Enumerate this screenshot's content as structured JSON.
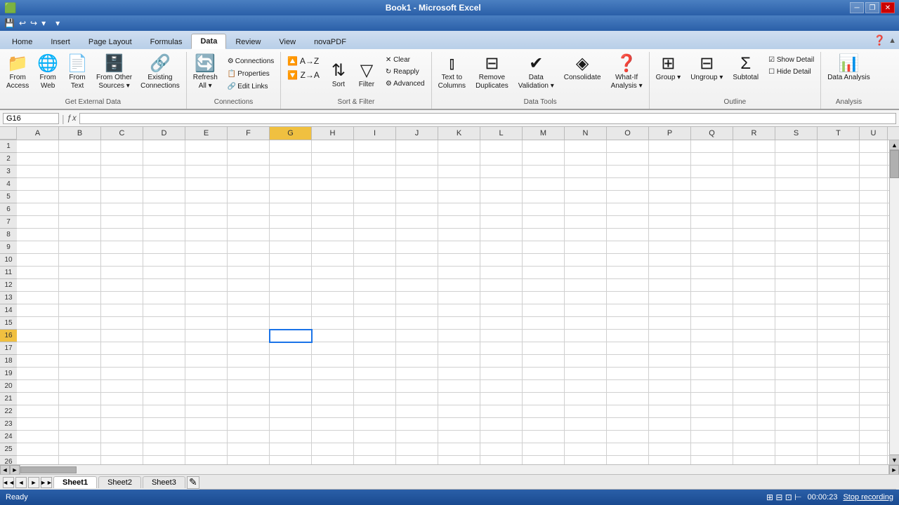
{
  "titleBar": {
    "title": "Book1 - Microsoft Excel",
    "minBtn": "─",
    "restoreBtn": "❐",
    "closeBtn": "✕"
  },
  "quickAccess": {
    "buttons": [
      "💾",
      "↩",
      "↪",
      "▾"
    ]
  },
  "ribbonTabs": {
    "tabs": [
      "Home",
      "Insert",
      "Page Layout",
      "Formulas",
      "Data",
      "Review",
      "View",
      "novaPDF"
    ],
    "activeTab": "Data"
  },
  "ribbon": {
    "groups": [
      {
        "id": "get-external-data",
        "label": "Get External Data",
        "buttons": [
          {
            "id": "from-access",
            "label": "From\nAccess",
            "icon": "📁"
          },
          {
            "id": "from-web",
            "label": "From\nWeb",
            "icon": "🌐"
          },
          {
            "id": "from-text",
            "label": "From\nText",
            "icon": "📄"
          },
          {
            "id": "from-other-sources",
            "label": "From Other\nSources",
            "icon": "🗄️",
            "hasDropdown": true
          },
          {
            "id": "existing-connections",
            "label": "Existing\nConnections",
            "icon": "🔗"
          }
        ]
      },
      {
        "id": "connections",
        "label": "Connections",
        "buttons": [
          {
            "id": "connections-btn",
            "label": "Connections",
            "small": true,
            "icon": "⚙"
          },
          {
            "id": "properties",
            "label": "Properties",
            "small": true,
            "icon": "📋"
          },
          {
            "id": "edit-links",
            "label": "Edit Links",
            "small": true,
            "icon": "🔗"
          },
          {
            "id": "refresh-all",
            "label": "Refresh\nAll",
            "icon": "🔄",
            "hasDropdown": true
          }
        ]
      },
      {
        "id": "sort-filter",
        "label": "Sort & Filter",
        "buttons": [
          {
            "id": "sort-asc",
            "label": "",
            "icon": "↑A↓Z",
            "small": true
          },
          {
            "id": "sort-desc",
            "label": "",
            "icon": "↑Z↓A",
            "small": true
          },
          {
            "id": "sort",
            "label": "Sort",
            "icon": "⇅"
          },
          {
            "id": "filter",
            "label": "Filter",
            "icon": "▽"
          },
          {
            "id": "clear",
            "label": "Clear",
            "small": true,
            "icon": "✕"
          },
          {
            "id": "reapply",
            "label": "Reapply",
            "small": true,
            "icon": "↻"
          },
          {
            "id": "advanced",
            "label": "Advanced",
            "small": true,
            "icon": "⚙"
          }
        ]
      },
      {
        "id": "data-tools",
        "label": "Data Tools",
        "buttons": [
          {
            "id": "text-to-columns",
            "label": "Text to\nColumns",
            "icon": "⫾"
          },
          {
            "id": "remove-duplicates",
            "label": "Remove\nDuplicates",
            "icon": "⊟"
          },
          {
            "id": "data-validation",
            "label": "Data\nValidation",
            "icon": "✔",
            "hasDropdown": true
          },
          {
            "id": "consolidate",
            "label": "Consolidate",
            "icon": "◈"
          },
          {
            "id": "what-if-analysis",
            "label": "What-If\nAnalysis",
            "icon": "❓",
            "hasDropdown": true
          }
        ]
      },
      {
        "id": "outline",
        "label": "Outline",
        "buttons": [
          {
            "id": "group",
            "label": "Group",
            "icon": "⊞",
            "hasDropdown": true
          },
          {
            "id": "ungroup",
            "label": "Ungroup",
            "icon": "⊟",
            "hasDropdown": true
          },
          {
            "id": "subtotal",
            "label": "Subtotal",
            "icon": "Σ"
          },
          {
            "id": "show-detail",
            "label": "Show Detail",
            "small": true
          },
          {
            "id": "hide-detail",
            "label": "Hide Detail",
            "small": true
          }
        ]
      },
      {
        "id": "analysis",
        "label": "Analysis",
        "buttons": [
          {
            "id": "data-analysis",
            "label": "Data Analysis",
            "icon": "📊"
          }
        ]
      }
    ]
  },
  "formulaBar": {
    "nameBox": "G16",
    "fx": "fx",
    "formula": ""
  },
  "grid": {
    "selectedCell": "G16",
    "selectedCol": "G",
    "selectedRow": 16,
    "columns": [
      "A",
      "B",
      "C",
      "D",
      "E",
      "F",
      "G",
      "H",
      "I",
      "J",
      "K",
      "L",
      "M",
      "N",
      "O",
      "P",
      "Q",
      "R",
      "S",
      "T",
      "U"
    ],
    "rowCount": 26
  },
  "sheets": {
    "tabs": [
      "Sheet1",
      "Sheet2",
      "Sheet3"
    ],
    "active": "Sheet1"
  },
  "statusBar": {
    "left": "Ready",
    "time": "00:00:23",
    "recording": "Stop recording"
  }
}
